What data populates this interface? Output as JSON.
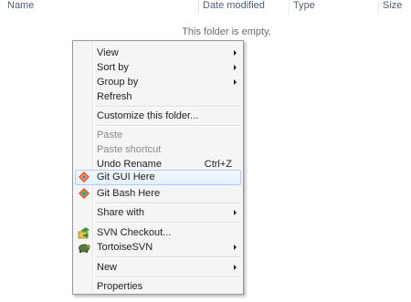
{
  "columns": {
    "name": "Name",
    "date_modified": "Date modified",
    "type": "Type",
    "size": "Size"
  },
  "empty_message": "This folder is empty.",
  "menu": {
    "view": "View",
    "sort_by": "Sort by",
    "group_by": "Group by",
    "refresh": "Refresh",
    "customize": "Customize this folder...",
    "paste": "Paste",
    "paste_shortcut": "Paste shortcut",
    "undo_rename": "Undo Rename",
    "undo_shortcut": "Ctrl+Z",
    "git_gui": "Git GUI Here",
    "git_bash": "Git Bash Here",
    "share_with": "Share with",
    "svn_checkout": "SVN Checkout...",
    "tortoise_svn": "TortoiseSVN",
    "new": "New",
    "properties": "Properties"
  },
  "icons": {
    "git_gui": "git-gui-icon",
    "git_bash": "git-bash-icon",
    "svn_checkout": "svn-checkout-icon",
    "tortoise_svn": "tortoise-svn-icon"
  },
  "colors": {
    "header_text": "#4c607a",
    "hover_border": "#aecff5",
    "menu_bg": "#f5f5f5",
    "disabled_text": "#8a8a8a"
  }
}
